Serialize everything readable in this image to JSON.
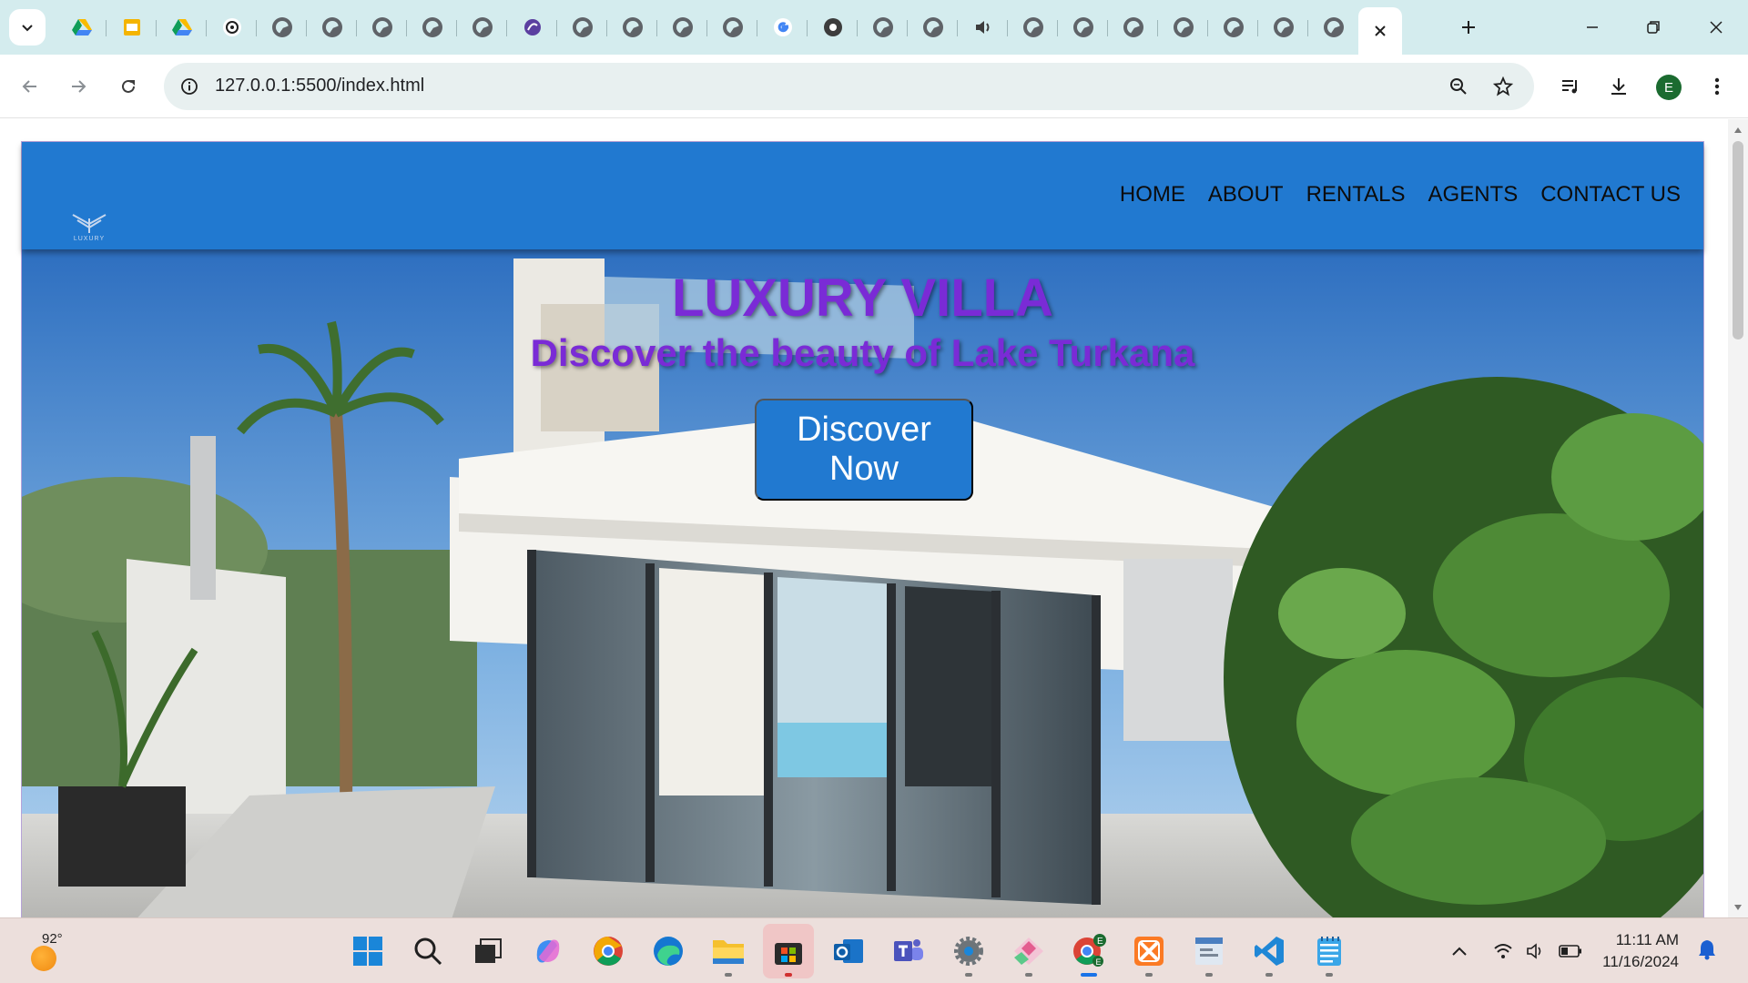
{
  "browser": {
    "url": "127.0.0.1:5500/index.html",
    "profile_initial": "E",
    "tabs": [
      {
        "icon": "google-drive-icon"
      },
      {
        "icon": "google-slides-icon"
      },
      {
        "icon": "google-drive-icon"
      },
      {
        "icon": "chatgpt-icon"
      },
      {
        "icon": "globe-icon"
      },
      {
        "icon": "globe-icon"
      },
      {
        "icon": "globe-icon"
      },
      {
        "icon": "globe-icon"
      },
      {
        "icon": "globe-icon"
      },
      {
        "icon": "chatbot-icon"
      },
      {
        "icon": "globe-icon"
      },
      {
        "icon": "globe-icon"
      },
      {
        "icon": "globe-icon"
      },
      {
        "icon": "globe-icon"
      },
      {
        "icon": "google-icon"
      },
      {
        "icon": "chrome-icon"
      },
      {
        "icon": "globe-icon"
      },
      {
        "icon": "globe-icon"
      },
      {
        "icon": "audio-playing-icon"
      },
      {
        "icon": "globe-icon"
      },
      {
        "icon": "globe-icon"
      },
      {
        "icon": "globe-icon"
      },
      {
        "icon": "globe-icon"
      },
      {
        "icon": "globe-icon"
      },
      {
        "icon": "globe-icon"
      },
      {
        "icon": "globe-icon"
      },
      {
        "icon": "globe-icon"
      }
    ]
  },
  "site": {
    "logo_text": "LUXURY",
    "nav": [
      "HOME",
      "ABOUT",
      "RENTALS",
      "AGENTS",
      "CONTACT US"
    ],
    "hero": {
      "title": "LUXURY VILLA",
      "subtitle": "Discover the beauty of Lake Turkana",
      "button_line1": "Discover",
      "button_line2": "Now"
    },
    "colors": {
      "nav_bg": "#2179d0",
      "heading": "#7a2bd6",
      "button_bg": "#2179d0"
    }
  },
  "taskbar": {
    "weather_temp": "92°",
    "time": "11:11 AM",
    "date": "11/16/2024",
    "apps": [
      "windows-start-icon",
      "search-icon",
      "task-view-icon",
      "copilot-icon",
      "chrome-icon",
      "edge-icon",
      "file-explorer-icon",
      "microsoft-store-icon",
      "outlook-icon",
      "teams-icon",
      "settings-icon",
      "git-app-icon",
      "chrome-profile-icon",
      "xampp-icon",
      "editor-app-icon",
      "vscode-icon",
      "notepad-icon"
    ]
  }
}
